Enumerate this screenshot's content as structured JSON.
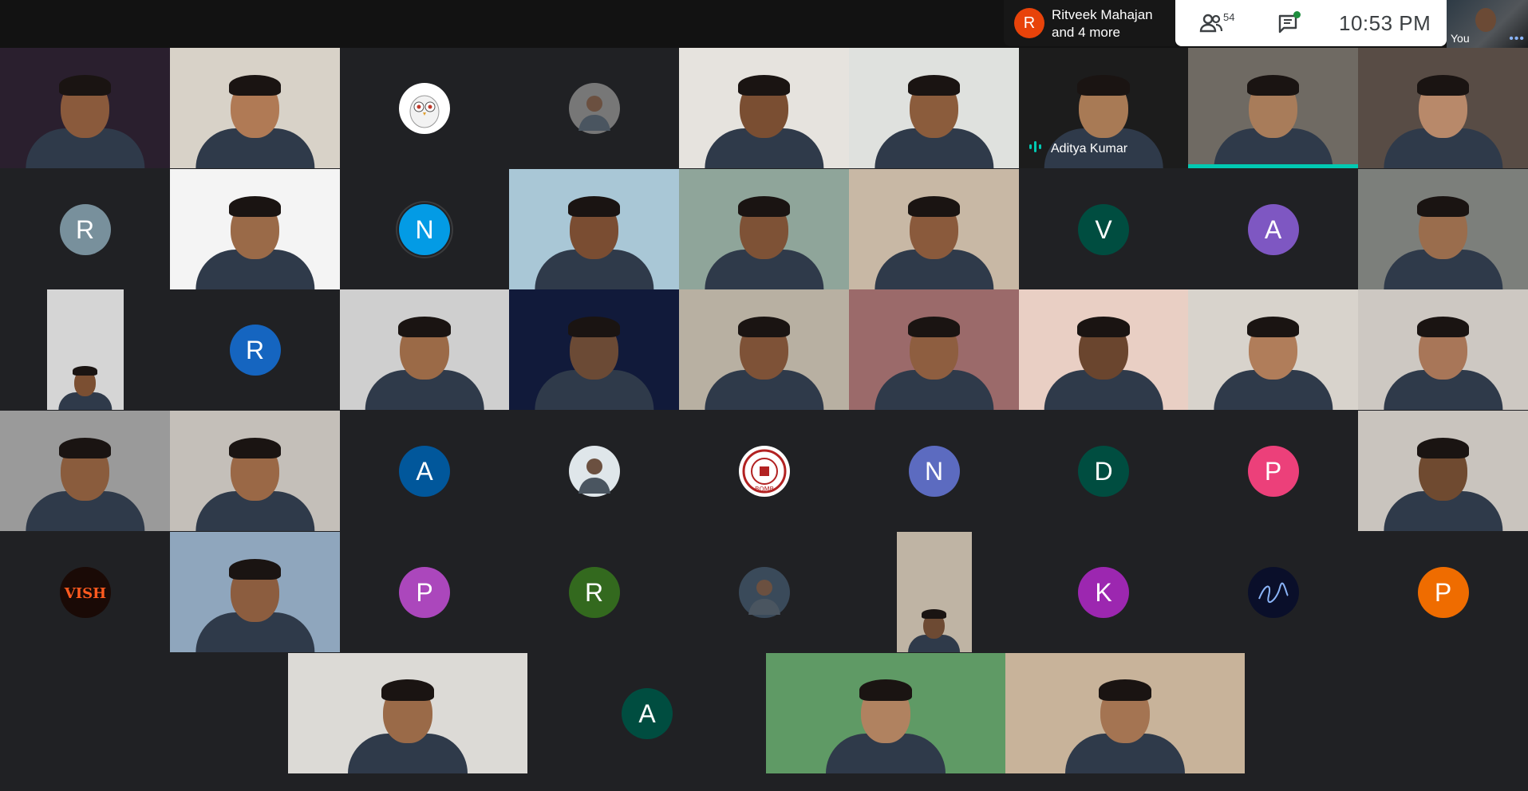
{
  "presenter": {
    "avatar_letter": "R",
    "line1": "Ritveek Mahajan",
    "line2": "and 4 more"
  },
  "controls": {
    "people_icon": "people-icon",
    "participant_count": "54",
    "chat_icon": "chat-icon",
    "time": "10:53  PM"
  },
  "self_view": {
    "label": "You",
    "more": "•••"
  },
  "tiles": [
    {
      "kind": "video",
      "bg": "#2a1f2e",
      "skin": "#8a5a3c"
    },
    {
      "kind": "video",
      "bg": "#d8d2c8",
      "skin": "#b07a55"
    },
    {
      "kind": "image-avatar",
      "bg": "#202124",
      "avatar_bg": "#ffffff",
      "icon": "owl-icon"
    },
    {
      "kind": "image-avatar",
      "bg": "#202124",
      "avatar_bg": "#777777",
      "icon": "photo-avatar-icon"
    },
    {
      "kind": "video",
      "bg": "#e6e3de",
      "skin": "#7a4e32"
    },
    {
      "kind": "video",
      "bg": "#dfe1de",
      "skin": "#8b5c3c"
    },
    {
      "kind": "video",
      "bg": "#1c1c1c",
      "skin": "#a87a55",
      "name": "Aditya Kumar",
      "speaking_icon": true
    },
    {
      "kind": "video",
      "bg": "#6f6a63",
      "skin": "#a87c5a",
      "speaking_bar": true
    },
    {
      "kind": "video",
      "bg": "#584c45",
      "skin": "#b8896a"
    },
    {
      "kind": "letter",
      "bg": "#202124",
      "avatar_bg": "#78909c",
      "letter": "R"
    },
    {
      "kind": "video",
      "bg": "#f4f4f4",
      "skin": "#9a6a48"
    },
    {
      "kind": "letter",
      "bg": "#202124",
      "avatar_bg": "#039be5",
      "letter": "N",
      "ring": true
    },
    {
      "kind": "video",
      "bg": "#a9c7d6",
      "skin": "#7a4d32"
    },
    {
      "kind": "video",
      "bg": "#8fa59a",
      "skin": "#7e5236"
    },
    {
      "kind": "video",
      "bg": "#c8b8a5",
      "skin": "#8a5a3c"
    },
    {
      "kind": "letter",
      "bg": "#202124",
      "avatar_bg": "#004d40",
      "letter": "V"
    },
    {
      "kind": "letter",
      "bg": "#202124",
      "avatar_bg": "#7e57c2",
      "letter": "A"
    },
    {
      "kind": "video",
      "bg": "#7c7f7b",
      "skin": "#9a6d4d"
    },
    {
      "kind": "video-small",
      "bg": "#202124",
      "inner": "#d5d5d5",
      "skin": "#7b4f32"
    },
    {
      "kind": "letter",
      "bg": "#202124",
      "avatar_bg": "#1565c0",
      "letter": "R"
    },
    {
      "kind": "video",
      "bg": "#cfcfcf",
      "skin": "#9b6a47"
    },
    {
      "kind": "video",
      "bg": "#111a3a",
      "skin": "#6b4a35"
    },
    {
      "kind": "video",
      "bg": "#b8b0a2",
      "skin": "#7e5237"
    },
    {
      "kind": "video",
      "bg": "#9b6a6a",
      "skin": "#8e5e40"
    },
    {
      "kind": "video",
      "bg": "#e9cfc4",
      "skin": "#6a452e"
    },
    {
      "kind": "video",
      "bg": "#d8d3cc",
      "skin": "#b07d5a"
    },
    {
      "kind": "video",
      "bg": "#cdc8c2",
      "skin": "#a87658"
    },
    {
      "kind": "video",
      "bg": "#9a9a9a",
      "skin": "#8a5c3d"
    },
    {
      "kind": "video",
      "bg": "#c4bfb9",
      "skin": "#9a6846"
    },
    {
      "kind": "letter",
      "bg": "#202124",
      "avatar_bg": "#01579b",
      "letter": "A"
    },
    {
      "kind": "image-avatar",
      "bg": "#202124",
      "avatar_bg": "#dfe6ea",
      "icon": "photo-avatar-icon"
    },
    {
      "kind": "image-avatar",
      "bg": "#202124",
      "avatar_bg": "#ffffff",
      "icon": "iit-bombay-logo-icon"
    },
    {
      "kind": "letter",
      "bg": "#202124",
      "avatar_bg": "#5c6bc0",
      "letter": "N"
    },
    {
      "kind": "letter",
      "bg": "#202124",
      "avatar_bg": "#004d40",
      "letter": "D"
    },
    {
      "kind": "letter",
      "bg": "#202124",
      "avatar_bg": "#ec407a",
      "letter": "P"
    },
    {
      "kind": "video",
      "bg": "#c9c4be",
      "skin": "#6f4a30"
    },
    {
      "kind": "image-avatar",
      "bg": "#202124",
      "avatar_bg": "#1a0a06",
      "icon": "vish-logo-icon"
    },
    {
      "kind": "video",
      "bg": "#8fa6bd",
      "skin": "#8c5d3f"
    },
    {
      "kind": "letter",
      "bg": "#202124",
      "avatar_bg": "#ab47bc",
      "letter": "P"
    },
    {
      "kind": "letter",
      "bg": "#202124",
      "avatar_bg": "#33691e",
      "letter": "R"
    },
    {
      "kind": "image-avatar",
      "bg": "#202124",
      "avatar_bg": "#3a4a5a",
      "icon": "photo-avatar-icon"
    },
    {
      "kind": "video-tall",
      "bg": "#202124",
      "inner": "#bfb4a4",
      "skin": "#6d4a33"
    },
    {
      "kind": "letter",
      "bg": "#202124",
      "avatar_bg": "#9c27b0",
      "letter": "K"
    },
    {
      "kind": "image-avatar",
      "bg": "#202124",
      "avatar_bg": "#0a0f2a",
      "icon": "signature-logo-icon"
    },
    {
      "kind": "letter",
      "bg": "#202124",
      "avatar_bg": "#ef6c00",
      "letter": "P"
    },
    {
      "kind": "video",
      "bg": "#dcdad6",
      "skin": "#9a6a48"
    },
    {
      "kind": "letter",
      "bg": "#202124",
      "avatar_bg": "#004d40",
      "letter": "A"
    },
    {
      "kind": "video",
      "bg": "#5f9a65",
      "skin": "#b08260"
    },
    {
      "kind": "video",
      "bg": "#c8b39a",
      "skin": "#a47452"
    }
  ]
}
